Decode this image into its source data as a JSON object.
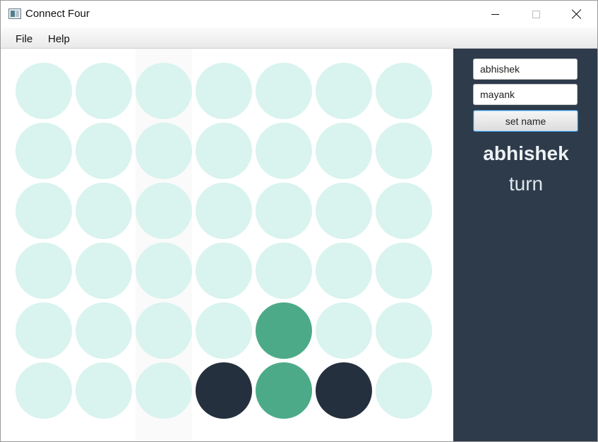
{
  "window": {
    "title": "Connect Four",
    "app_icon": "window-app-icon",
    "controls": {
      "minimize_icon": "minimize-icon",
      "maximize_icon": "maximize-icon",
      "close_icon": "close-icon"
    }
  },
  "menu": {
    "items": [
      {
        "label": "File"
      },
      {
        "label": "Help"
      }
    ]
  },
  "board": {
    "rows": 6,
    "columns": 7,
    "hovered_column": 3,
    "colors": {
      "empty": "#d9f3ee",
      "player1": "#4caa88",
      "player2": "#24303d"
    },
    "grid": [
      [
        "empty",
        "empty",
        "empty",
        "empty",
        "empty",
        "empty",
        "empty"
      ],
      [
        "empty",
        "empty",
        "empty",
        "empty",
        "empty",
        "empty",
        "empty"
      ],
      [
        "empty",
        "empty",
        "empty",
        "empty",
        "empty",
        "empty",
        "empty"
      ],
      [
        "empty",
        "empty",
        "empty",
        "empty",
        "empty",
        "empty",
        "empty"
      ],
      [
        "empty",
        "empty",
        "empty",
        "empty",
        "player1",
        "empty",
        "empty"
      ],
      [
        "empty",
        "empty",
        "empty",
        "player2",
        "player1",
        "player2",
        "empty"
      ]
    ]
  },
  "side_panel": {
    "background": "#2e3b4b",
    "player1_name": "abhishek",
    "player2_name": "mayank",
    "set_name_button": "set name",
    "current_player": "abhishek",
    "turn_label": "turn"
  }
}
